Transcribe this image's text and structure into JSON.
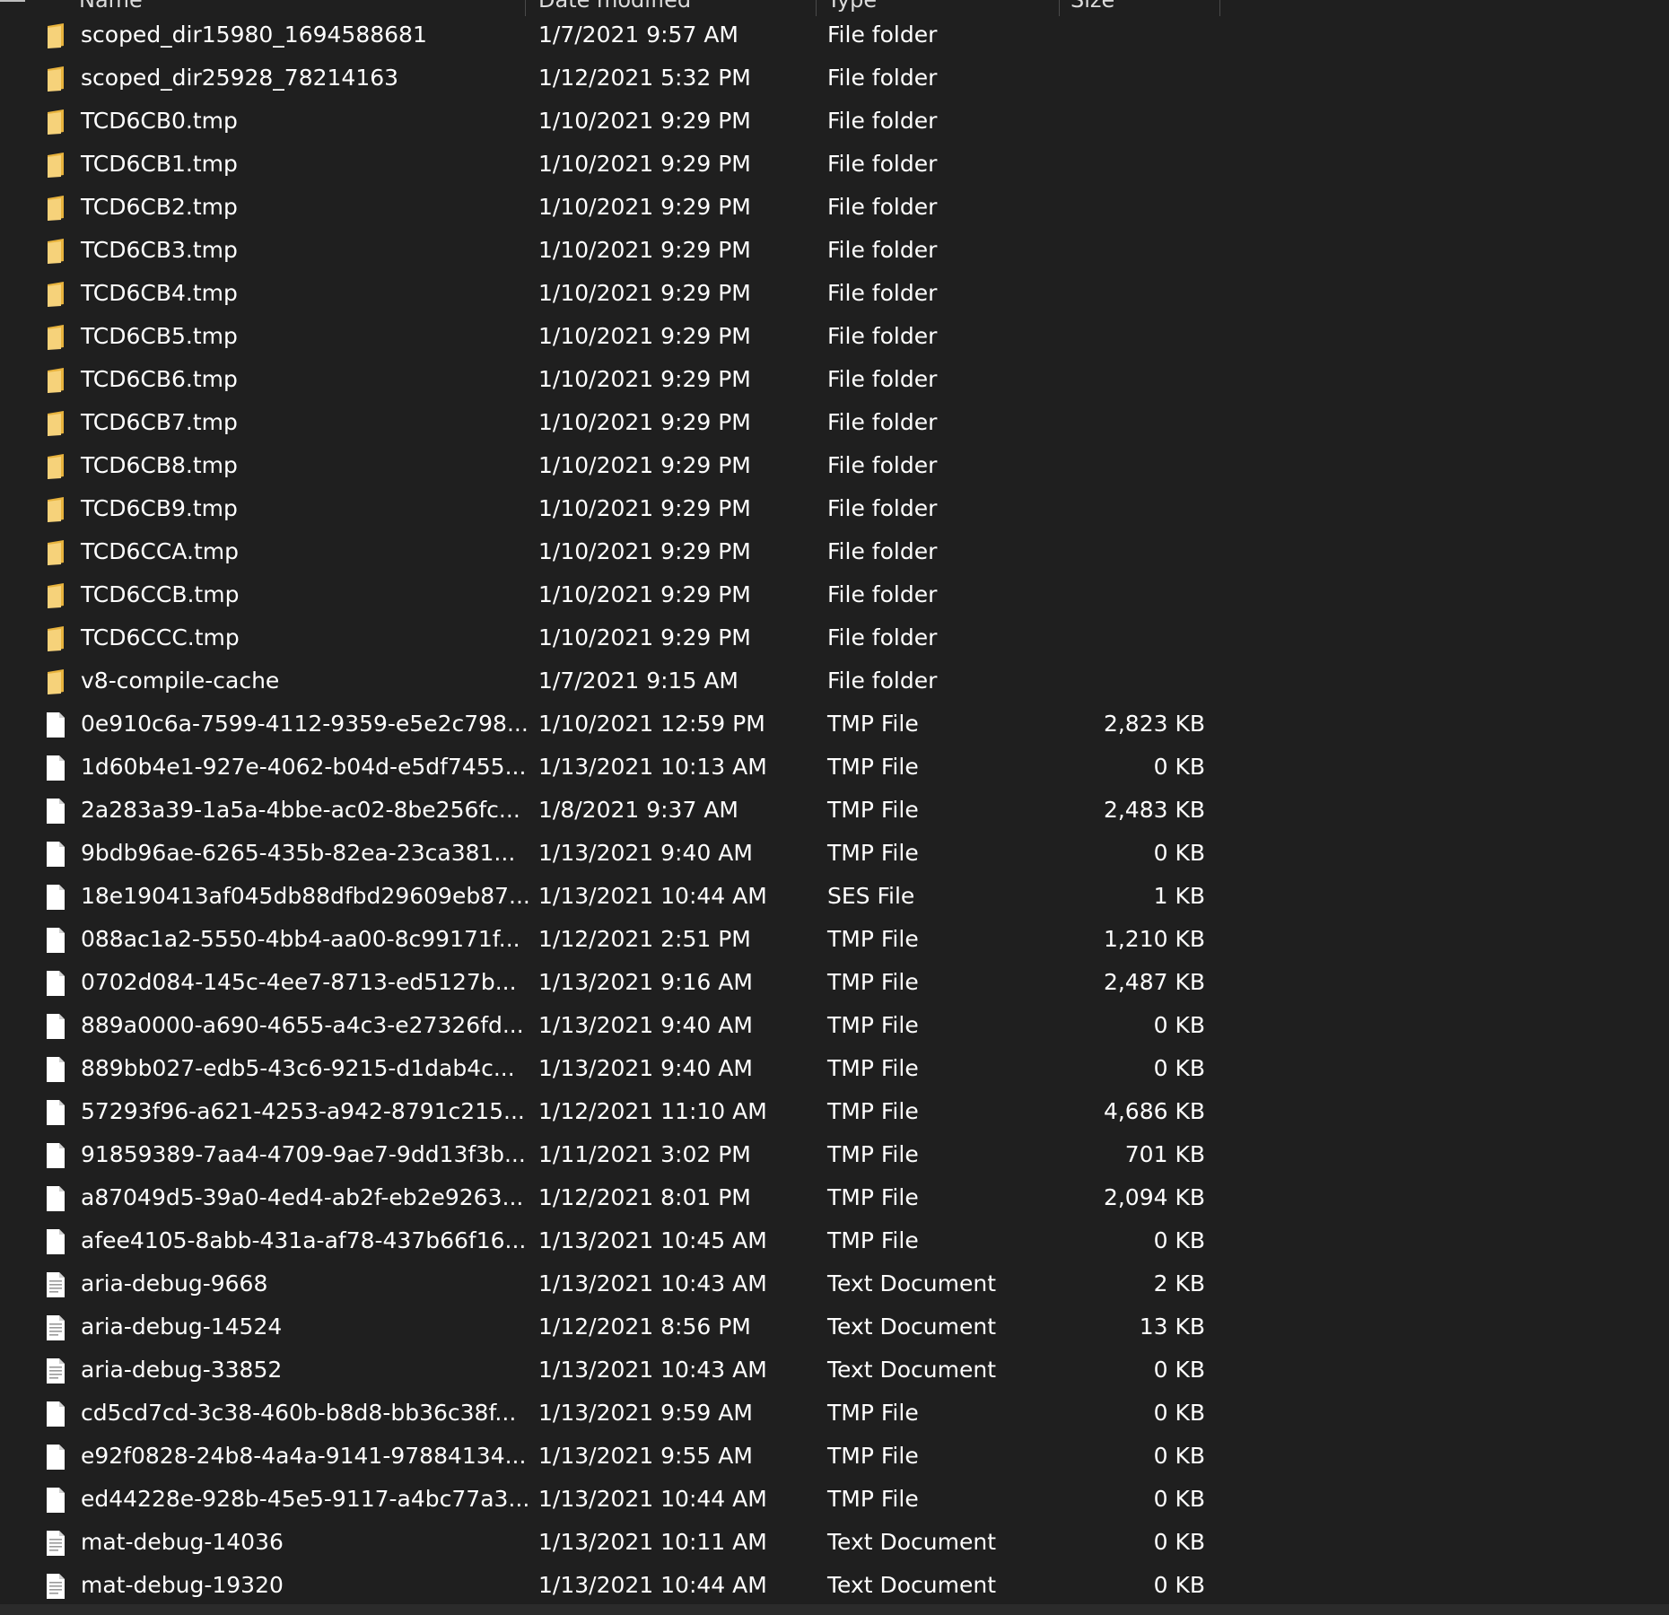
{
  "header": {
    "columns": [
      "Name",
      "Date modified",
      "Type",
      "Size"
    ]
  },
  "colors": {
    "background": "#1f1f1f",
    "text": "#ffffff",
    "folder": "#f2c55c",
    "file": "#ffffff"
  },
  "files": [
    {
      "icon": "folder-icon",
      "name": "scoped_dir15980_1694588681",
      "date": "1/7/2021 9:57 AM",
      "type": "File folder",
      "size": ""
    },
    {
      "icon": "folder-icon",
      "name": "scoped_dir25928_78214163",
      "date": "1/12/2021 5:32 PM",
      "type": "File folder",
      "size": ""
    },
    {
      "icon": "folder-icon",
      "name": "TCD6CB0.tmp",
      "date": "1/10/2021 9:29 PM",
      "type": "File folder",
      "size": ""
    },
    {
      "icon": "folder-icon",
      "name": "TCD6CB1.tmp",
      "date": "1/10/2021 9:29 PM",
      "type": "File folder",
      "size": ""
    },
    {
      "icon": "folder-icon",
      "name": "TCD6CB2.tmp",
      "date": "1/10/2021 9:29 PM",
      "type": "File folder",
      "size": ""
    },
    {
      "icon": "folder-icon",
      "name": "TCD6CB3.tmp",
      "date": "1/10/2021 9:29 PM",
      "type": "File folder",
      "size": ""
    },
    {
      "icon": "folder-icon",
      "name": "TCD6CB4.tmp",
      "date": "1/10/2021 9:29 PM",
      "type": "File folder",
      "size": ""
    },
    {
      "icon": "folder-icon",
      "name": "TCD6CB5.tmp",
      "date": "1/10/2021 9:29 PM",
      "type": "File folder",
      "size": ""
    },
    {
      "icon": "folder-icon",
      "name": "TCD6CB6.tmp",
      "date": "1/10/2021 9:29 PM",
      "type": "File folder",
      "size": ""
    },
    {
      "icon": "folder-icon",
      "name": "TCD6CB7.tmp",
      "date": "1/10/2021 9:29 PM",
      "type": "File folder",
      "size": ""
    },
    {
      "icon": "folder-icon",
      "name": "TCD6CB8.tmp",
      "date": "1/10/2021 9:29 PM",
      "type": "File folder",
      "size": ""
    },
    {
      "icon": "folder-icon",
      "name": "TCD6CB9.tmp",
      "date": "1/10/2021 9:29 PM",
      "type": "File folder",
      "size": ""
    },
    {
      "icon": "folder-icon",
      "name": "TCD6CCA.tmp",
      "date": "1/10/2021 9:29 PM",
      "type": "File folder",
      "size": ""
    },
    {
      "icon": "folder-icon",
      "name": "TCD6CCB.tmp",
      "date": "1/10/2021 9:29 PM",
      "type": "File folder",
      "size": ""
    },
    {
      "icon": "folder-icon",
      "name": "TCD6CCC.tmp",
      "date": "1/10/2021 9:29 PM",
      "type": "File folder",
      "size": ""
    },
    {
      "icon": "folder-icon",
      "name": "v8-compile-cache",
      "date": "1/7/2021 9:15 AM",
      "type": "File folder",
      "size": ""
    },
    {
      "icon": "file-icon",
      "name": "0e910c6a-7599-4112-9359-e5e2c798...",
      "date": "1/10/2021 12:59 PM",
      "type": "TMP File",
      "size": "2,823 KB"
    },
    {
      "icon": "file-icon",
      "name": "1d60b4e1-927e-4062-b04d-e5df7455...",
      "date": "1/13/2021 10:13 AM",
      "type": "TMP File",
      "size": "0 KB"
    },
    {
      "icon": "file-icon",
      "name": "2a283a39-1a5a-4bbe-ac02-8be256fc...",
      "date": "1/8/2021 9:37 AM",
      "type": "TMP File",
      "size": "2,483 KB"
    },
    {
      "icon": "file-icon",
      "name": "9bdb96ae-6265-435b-82ea-23ca381...",
      "date": "1/13/2021 9:40 AM",
      "type": "TMP File",
      "size": "0 KB"
    },
    {
      "icon": "file-icon",
      "name": "18e190413af045db88dfbd29609eb87...",
      "date": "1/13/2021 10:44 AM",
      "type": "SES File",
      "size": "1 KB"
    },
    {
      "icon": "file-icon",
      "name": "088ac1a2-5550-4bb4-aa00-8c99171f...",
      "date": "1/12/2021 2:51 PM",
      "type": "TMP File",
      "size": "1,210 KB"
    },
    {
      "icon": "file-icon",
      "name": "0702d084-145c-4ee7-8713-ed5127b...",
      "date": "1/13/2021 9:16 AM",
      "type": "TMP File",
      "size": "2,487 KB"
    },
    {
      "icon": "file-icon",
      "name": "889a0000-a690-4655-a4c3-e27326fd...",
      "date": "1/13/2021 9:40 AM",
      "type": "TMP File",
      "size": "0 KB"
    },
    {
      "icon": "file-icon",
      "name": "889bb027-edb5-43c6-9215-d1dab4c...",
      "date": "1/13/2021 9:40 AM",
      "type": "TMP File",
      "size": "0 KB"
    },
    {
      "icon": "file-icon",
      "name": "57293f96-a621-4253-a942-8791c215...",
      "date": "1/12/2021 11:10 AM",
      "type": "TMP File",
      "size": "4,686 KB"
    },
    {
      "icon": "file-icon",
      "name": "91859389-7aa4-4709-9ae7-9dd13f3b...",
      "date": "1/11/2021 3:02 PM",
      "type": "TMP File",
      "size": "701 KB"
    },
    {
      "icon": "file-icon",
      "name": "a87049d5-39a0-4ed4-ab2f-eb2e9263...",
      "date": "1/12/2021 8:01 PM",
      "type": "TMP File",
      "size": "2,094 KB"
    },
    {
      "icon": "file-icon",
      "name": "afee4105-8abb-431a-af78-437b66f16...",
      "date": "1/13/2021 10:45 AM",
      "type": "TMP File",
      "size": "0 KB"
    },
    {
      "icon": "text-file-icon",
      "name": "aria-debug-9668",
      "date": "1/13/2021 10:43 AM",
      "type": "Text Document",
      "size": "2 KB"
    },
    {
      "icon": "text-file-icon",
      "name": "aria-debug-14524",
      "date": "1/12/2021 8:56 PM",
      "type": "Text Document",
      "size": "13 KB"
    },
    {
      "icon": "text-file-icon",
      "name": "aria-debug-33852",
      "date": "1/13/2021 10:43 AM",
      "type": "Text Document",
      "size": "0 KB"
    },
    {
      "icon": "file-icon",
      "name": "cd5cd7cd-3c38-460b-b8d8-bb36c38f...",
      "date": "1/13/2021 9:59 AM",
      "type": "TMP File",
      "size": "0 KB"
    },
    {
      "icon": "file-icon",
      "name": "e92f0828-24b8-4a4a-9141-97884134...",
      "date": "1/13/2021 9:55 AM",
      "type": "TMP File",
      "size": "0 KB"
    },
    {
      "icon": "file-icon",
      "name": "ed44228e-928b-45e5-9117-a4bc77a3...",
      "date": "1/13/2021 10:44 AM",
      "type": "TMP File",
      "size": "0 KB"
    },
    {
      "icon": "text-file-icon",
      "name": "mat-debug-14036",
      "date": "1/13/2021 10:11 AM",
      "type": "Text Document",
      "size": "0 KB"
    },
    {
      "icon": "text-file-icon",
      "name": "mat-debug-19320",
      "date": "1/13/2021 10:44 AM",
      "type": "Text Document",
      "size": "0 KB"
    }
  ]
}
